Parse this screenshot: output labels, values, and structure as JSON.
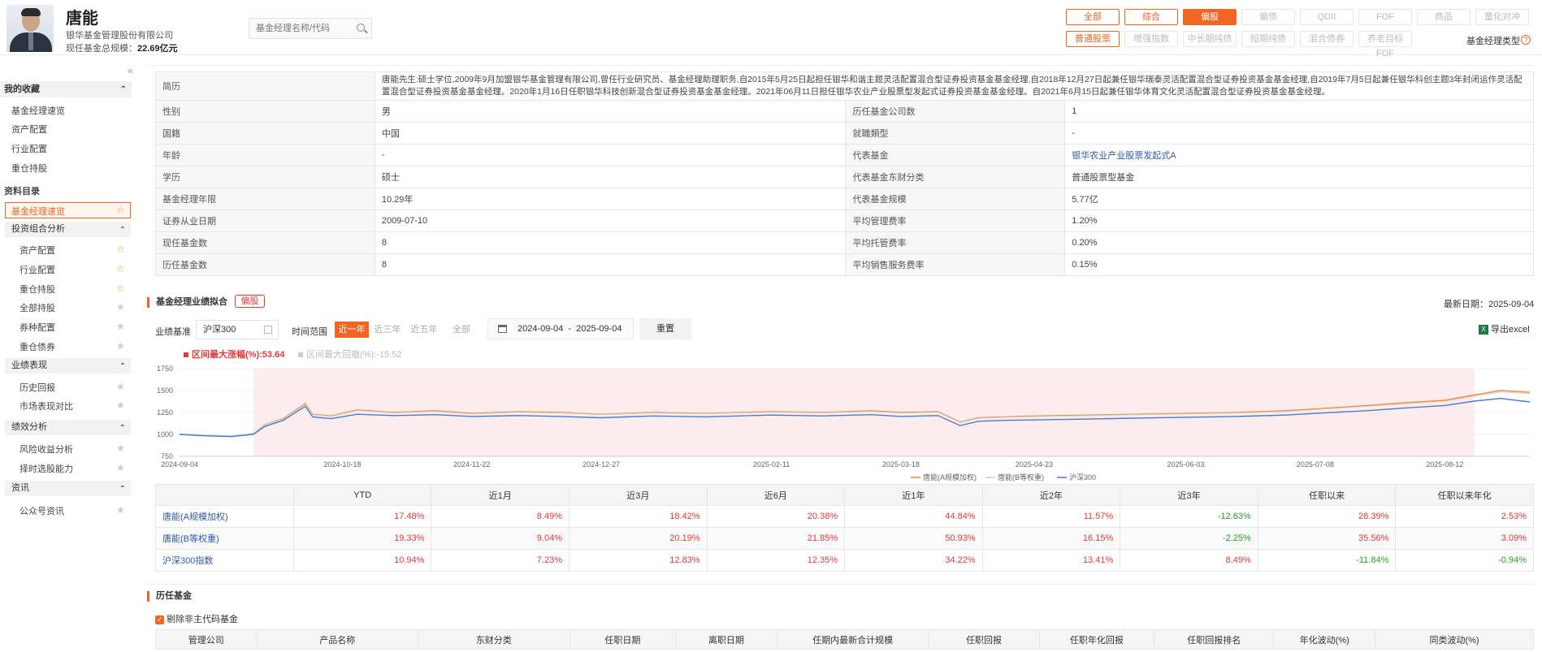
{
  "header": {
    "name": "唐能",
    "company": "银华基金管理股份有限公司",
    "scale_label": "现任基金总规模：",
    "scale_value": "22.69亿元",
    "search_placeholder": "基金经理名称/代码",
    "type_tabs_row1": [
      "全部",
      "综合",
      "偏股",
      "偏债",
      "QDII",
      "FOF",
      "商品",
      "量化对冲"
    ],
    "type_tabs_row2": [
      "普通股票",
      "增强指数",
      "中长期纯债",
      "短期纯债",
      "混合债券",
      "养老目标FOF"
    ],
    "manager_type_label": "基金经理类型"
  },
  "sidebar": {
    "favorites_title": "我的收藏",
    "favorites": [
      "基金经理速览",
      "资产配置",
      "行业配置",
      "重仓持股"
    ],
    "catalog_title": "资料目录",
    "current": "基金经理速览",
    "groups": [
      {
        "title": "投资组合分析",
        "items": [
          "资产配置",
          "行业配置",
          "重仓持股",
          "全部持股",
          "券种配置",
          "重仓债券"
        ]
      },
      {
        "title": "业绩表现",
        "items": [
          "历史回报",
          "市场表现对比"
        ]
      },
      {
        "title": "绩效分析",
        "items": [
          "风险收益分析",
          "择时选股能力"
        ]
      },
      {
        "title": "资讯",
        "items": [
          "公众号资讯"
        ]
      }
    ]
  },
  "profile": {
    "bio_label": "简历",
    "bio": "唐能先生:硕士学位,2009年9月加盟银华基金管理有限公司,曾任行业研究员、基金经理助理职务,自2015年5月25日起担任银华和谐主题灵活配置混合型证券投资基金基金经理,自2018年12月27日起兼任银华瑞泰灵活配置混合型证券投资基金基金经理,自2019年7月5日起兼任银华科创主题3年封闭运作灵活配置混合型证券投资基金基金经理。2020年1月16日任职银华科技创新混合型证券投资基金基金经理。2021年06月11日担任银华农业产业股票型发起式证券投资基金基金经理。自2021年6月15日起兼任银华体育文化灵活配置混合型证券投资基金基金经理。",
    "rows": [
      {
        "k1": "性别",
        "v1": "男",
        "k2": "历任基金公司数",
        "v2": "1"
      },
      {
        "k1": "国籍",
        "v1": "中国",
        "k2": "就職類型",
        "v2": "-"
      },
      {
        "k1": "年龄",
        "v1": "-",
        "k2": "代表基金",
        "v2": "银华农业产业股票发起式A"
      },
      {
        "k1": "学历",
        "v1": "硕士",
        "k2": "代表基金东财分类",
        "v2": "普通股票型基金"
      },
      {
        "k1": "基金经理年限",
        "v1": "10.29年",
        "k2": "代表基金规模",
        "v2": "5.77亿"
      },
      {
        "k1": "证券从业日期",
        "v1": "2009-07-10",
        "k2": "平均管理费率",
        "v2": "1.20%"
      },
      {
        "k1": "现任基金数",
        "v1": "8",
        "k2": "平均托管费率",
        "v2": "0.20%"
      },
      {
        "k1": "历任基金数",
        "v1": "8",
        "k2": "平均销售服务费率",
        "v2": "0.15%"
      }
    ]
  },
  "perf": {
    "title": "基金经理业绩拟合",
    "badge": "偏股",
    "latest_label": "最新日期：",
    "latest_date": "2025-09-04",
    "bench_label": "业绩基准",
    "bench_value": "沪深300",
    "range_label": "时间范围",
    "ranges": [
      "近一年",
      "近三年",
      "近五年",
      "全部"
    ],
    "date_from": "2024-09-04",
    "date_to": "2025-09-04",
    "reset": "重置",
    "export": "导出excel",
    "max_rise_label": "区间最大涨幅(%):",
    "max_rise": "53.64",
    "max_dd_label": "区间最大回撤(%):",
    "max_dd": "-15.52"
  },
  "colors": {
    "accent": "#f26522",
    "series_a": "#f08a3c",
    "series_b": "#cfcfcf",
    "bench": "#4a7bd0",
    "band": "#fdecec",
    "pos": "#e03c3c",
    "neg": "#2a9d2a"
  },
  "chart_data": {
    "type": "line",
    "ylim": [
      750,
      1750
    ],
    "yticks": [
      750,
      1000,
      1250,
      1500,
      1750
    ],
    "xlabels": [
      "2024-09-04",
      "2024-10-18",
      "2024-11-22",
      "2024-12-27",
      "2025-02-11",
      "2025-03-18",
      "2025-04-23",
      "2025-06-03",
      "2025-07-08",
      "2025-08-12"
    ],
    "band": [
      "2024-09-24",
      "2025-08-20"
    ],
    "x": [
      "2024-09-04",
      "2024-09-10",
      "2024-09-18",
      "2024-09-24",
      "2024-09-27",
      "2024-10-02",
      "2024-10-08",
      "2024-10-10",
      "2024-10-15",
      "2024-10-22",
      "2024-11-01",
      "2024-11-12",
      "2024-11-22",
      "2024-12-05",
      "2024-12-16",
      "2024-12-27",
      "2025-01-10",
      "2025-01-24",
      "2025-02-11",
      "2025-02-25",
      "2025-03-10",
      "2025-03-18",
      "2025-03-28",
      "2025-04-03",
      "2025-04-08",
      "2025-04-15",
      "2025-04-23",
      "2025-05-08",
      "2025-05-20",
      "2025-06-03",
      "2025-06-17",
      "2025-06-30",
      "2025-07-08",
      "2025-07-22",
      "2025-08-01",
      "2025-08-12",
      "2025-08-20",
      "2025-08-27",
      "2025-09-04"
    ],
    "series": [
      {
        "name": "唐能(A规模加权)",
        "values": [
          1000,
          990,
          980,
          1010,
          1110,
          1180,
          1350,
          1230,
          1210,
          1280,
          1250,
          1270,
          1240,
          1260,
          1250,
          1230,
          1250,
          1240,
          1260,
          1250,
          1270,
          1250,
          1260,
          1140,
          1190,
          1200,
          1210,
          1220,
          1230,
          1240,
          1250,
          1270,
          1290,
          1330,
          1360,
          1390,
          1450,
          1500,
          1480
        ]
      },
      {
        "name": "唐能(B等权重)",
        "values": [
          1000,
          992,
          984,
          1012,
          1108,
          1176,
          1340,
          1225,
          1205,
          1272,
          1245,
          1262,
          1234,
          1254,
          1244,
          1226,
          1244,
          1236,
          1254,
          1246,
          1262,
          1244,
          1254,
          1136,
          1184,
          1194,
          1204,
          1214,
          1224,
          1234,
          1244,
          1262,
          1282,
          1320,
          1348,
          1378,
          1436,
          1484,
          1466
        ]
      },
      {
        "name": "沪深300",
        "values": [
          1000,
          985,
          975,
          1000,
          1090,
          1160,
          1320,
          1200,
          1180,
          1230,
          1215,
          1225,
          1205,
          1215,
          1205,
          1190,
          1210,
          1200,
          1220,
          1210,
          1225,
          1205,
          1215,
          1100,
          1150,
          1160,
          1165,
          1175,
          1185,
          1195,
          1205,
          1220,
          1240,
          1270,
          1300,
          1330,
          1380,
          1410,
          1370
        ]
      }
    ]
  },
  "perf_table": {
    "headers": [
      "",
      "YTD",
      "近1月",
      "近3月",
      "近6月",
      "近1年",
      "近2年",
      "近3年",
      "任职以来",
      "任职以来年化"
    ],
    "rows": [
      {
        "name": "唐能(A规模加权)",
        "vals": [
          "17.48%",
          "8.49%",
          "18.42%",
          "20.38%",
          "44.84%",
          "11.57%",
          "-12.63%",
          "28.39%",
          "2.53%"
        ]
      },
      {
        "name": "唐能(B等权重)",
        "vals": [
          "19.33%",
          "9.04%",
          "20.19%",
          "21.85%",
          "50.93%",
          "16.15%",
          "-2.25%",
          "35.56%",
          "3.09%"
        ]
      },
      {
        "name": "沪深300指数",
        "vals": [
          "10.94%",
          "7.23%",
          "12.83%",
          "12.35%",
          "34.22%",
          "13.41%",
          "8.49%",
          "-11.84%",
          "-0.94%"
        ]
      }
    ]
  },
  "history": {
    "title": "历任基金",
    "checkbox": "剔除非主代码基金",
    "headers": [
      "管理公司",
      "产品名称",
      "东财分类",
      "任职日期",
      "离职日期",
      "任期内最新合计规模",
      "任职回报",
      "任职年化回报",
      "任职回报排名",
      "年化波动(%)",
      "同类波动(%)"
    ]
  }
}
